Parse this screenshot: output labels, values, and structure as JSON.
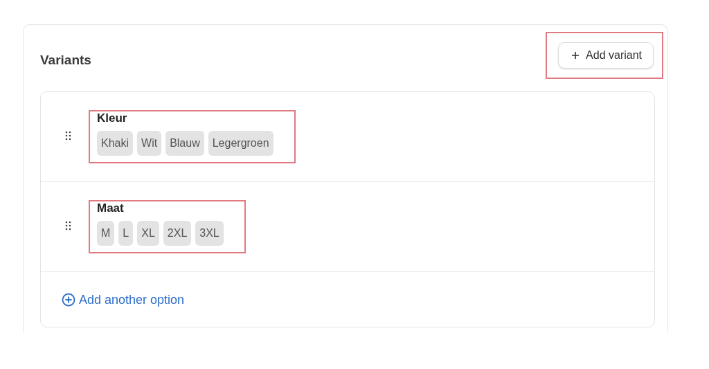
{
  "card": {
    "title": "Variants",
    "add_button": {
      "label": "Add variant",
      "highlighted": true
    },
    "options": [
      {
        "name": "Kleur",
        "highlighted": true,
        "values": [
          "Khaki",
          "Wit",
          "Blauw",
          "Legergroen"
        ]
      },
      {
        "name": "Maat",
        "highlighted": true,
        "values": [
          "M",
          "L",
          "XL",
          "2XL",
          "3XL"
        ]
      }
    ],
    "add_option_link": "Add another option"
  }
}
